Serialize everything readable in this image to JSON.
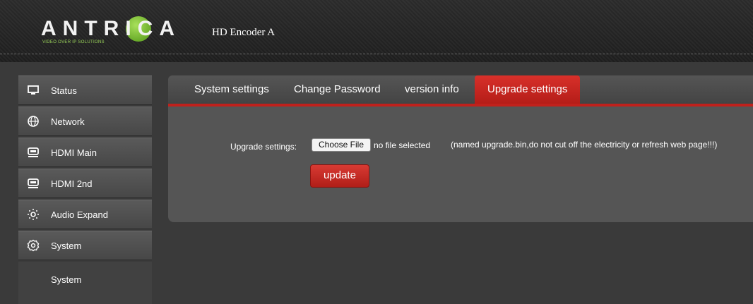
{
  "header": {
    "logo_text": "ANTRICA",
    "logo_tagline": "VIDEO OVER IP SOLUTIONS",
    "device_name": "HD Encoder  A"
  },
  "sidebar": {
    "items": [
      {
        "label": "Status",
        "icon": "monitor-icon"
      },
      {
        "label": "Network",
        "icon": "globe-icon"
      },
      {
        "label": "HDMI Main",
        "icon": "hdmi-icon"
      },
      {
        "label": "HDMI 2nd",
        "icon": "hdmi-icon"
      },
      {
        "label": "Audio Expand",
        "icon": "audio-icon"
      },
      {
        "label": "System",
        "icon": "gear-icon"
      }
    ],
    "subitems": [
      {
        "label": "System"
      }
    ]
  },
  "tabs": [
    {
      "label": "System settings",
      "active": false
    },
    {
      "label": "Change Password",
      "active": false
    },
    {
      "label": "version info",
      "active": false
    },
    {
      "label": "Upgrade settings",
      "active": true
    }
  ],
  "upgrade": {
    "field_label": "Upgrade settings:",
    "choose_file_label": "Choose File",
    "file_status": "no file selected",
    "hint": "(named upgrade.bin,do not cut off the electricity or refresh web page!!!)",
    "update_label": "update"
  },
  "colors": {
    "accent": "#c0211c",
    "background": "#3a3a3a",
    "panel": "#555555",
    "logo_green": "#8cc63f"
  }
}
